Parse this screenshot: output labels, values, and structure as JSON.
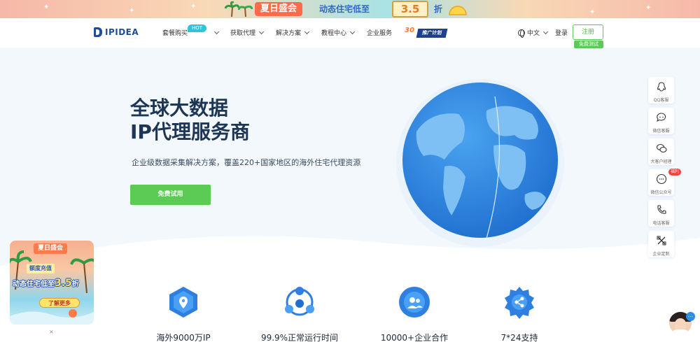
{
  "promo_banner": {
    "title": "夏日盛会",
    "subtitle": "动态住宅低至",
    "number": "3.5",
    "suffix": "折"
  },
  "nav": {
    "logo": "IPIDEA",
    "items": [
      {
        "label": "套餐购买"
      },
      {
        "label": "获取代理"
      },
      {
        "label": "解决方案"
      },
      {
        "label": "教程中心"
      },
      {
        "label": "企业服务"
      }
    ],
    "hot_badge": "HOT",
    "ad_badge_number": "30",
    "ad_badge_label": "推广计划",
    "language": "中文",
    "login": "登录",
    "register": "注册",
    "free_tag": "免费测试"
  },
  "hero": {
    "title_line1": "全球大数据",
    "title_line2": "IP代理服务商",
    "description": "企业级数据采集解决方案，覆盖220+国家地区的海外住宅代理资源",
    "cta": "免费试用"
  },
  "features": [
    {
      "label": "海外9000万IP",
      "icon": "location-hex-icon"
    },
    {
      "label": "99.9%正常运行时间",
      "icon": "network-icon"
    },
    {
      "label": "10000+企业合作",
      "icon": "users-circle-icon"
    },
    {
      "label": "7*24支持",
      "icon": "gear-share-icon"
    }
  ],
  "sidebar": [
    {
      "label": "QQ客服",
      "icon": "qq-icon"
    },
    {
      "label": "微信客服",
      "icon": "chat-icon"
    },
    {
      "label": "大客户经理",
      "icon": "wechat-icon"
    },
    {
      "label": "微信公众号",
      "icon": "message-icon"
    },
    {
      "label": "电话客服",
      "icon": "phone-icon"
    },
    {
      "label": "企业定制",
      "icon": "tools-icon"
    }
  ],
  "sidebar_badge": "福利",
  "promo_card": {
    "title": "夏日盛会",
    "sub": "额度充值",
    "main_text": "动态住宅低至",
    "number": "3.5",
    "suffix": "折",
    "button": "了解更多",
    "close": "×"
  },
  "colors": {
    "primary_green": "#5ccb54",
    "brand_blue": "#1f4d96",
    "globe_blue": "#2f86dd"
  }
}
